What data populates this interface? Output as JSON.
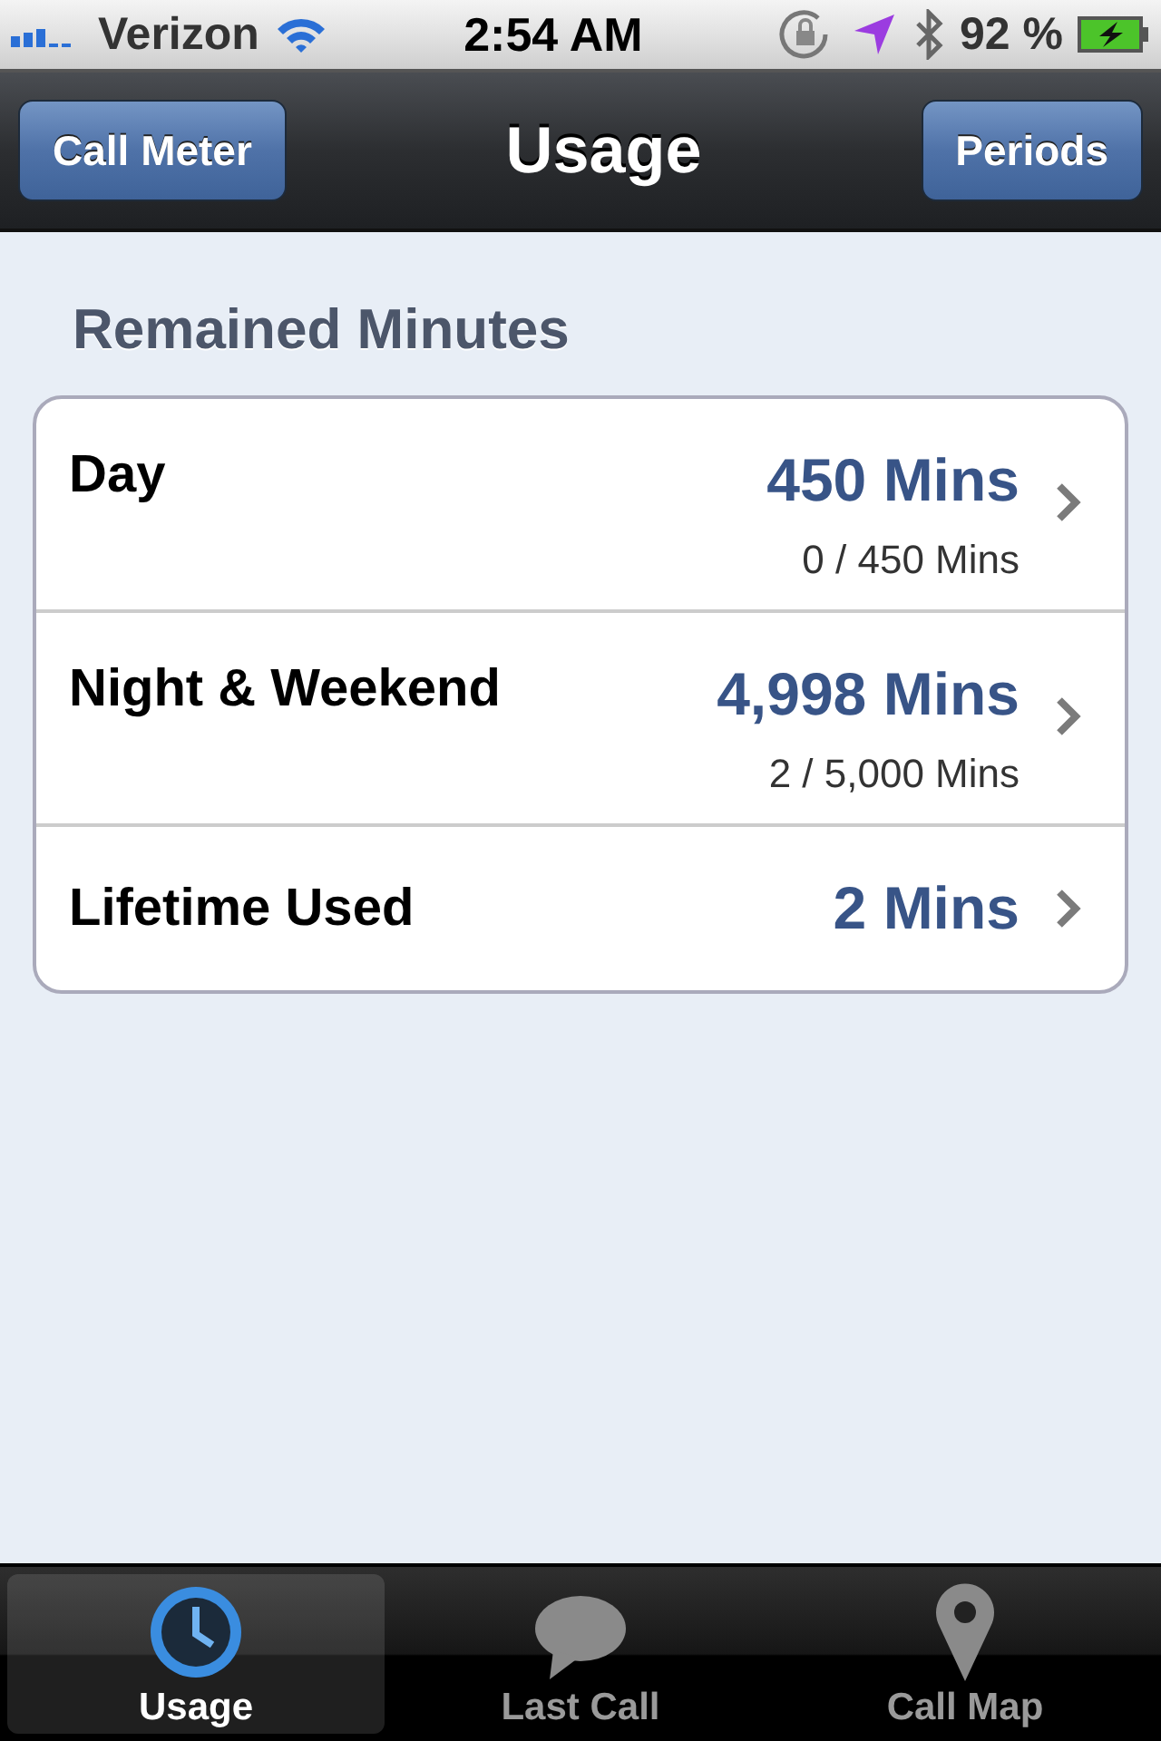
{
  "status_bar": {
    "carrier": "Verizon",
    "time": "2:54 AM",
    "battery": "92 %"
  },
  "nav_bar": {
    "left_button": "Call Meter",
    "title": "Usage",
    "right_button": "Periods"
  },
  "section": {
    "title": "Remained Minutes",
    "rows": [
      {
        "label": "Day",
        "value": "450 Mins",
        "detail": "0 / 450 Mins"
      },
      {
        "label": "Night & Weekend",
        "value": "4,998 Mins",
        "detail": "2 / 5,000 Mins"
      },
      {
        "label": "Lifetime Used",
        "value": "2 Mins"
      }
    ]
  },
  "tab_bar": [
    {
      "label": "Usage",
      "kind": "clock",
      "selected": true
    },
    {
      "label": "Last Call",
      "kind": "bubble",
      "selected": false
    },
    {
      "label": "Call Map",
      "kind": "pin",
      "selected": false
    }
  ]
}
